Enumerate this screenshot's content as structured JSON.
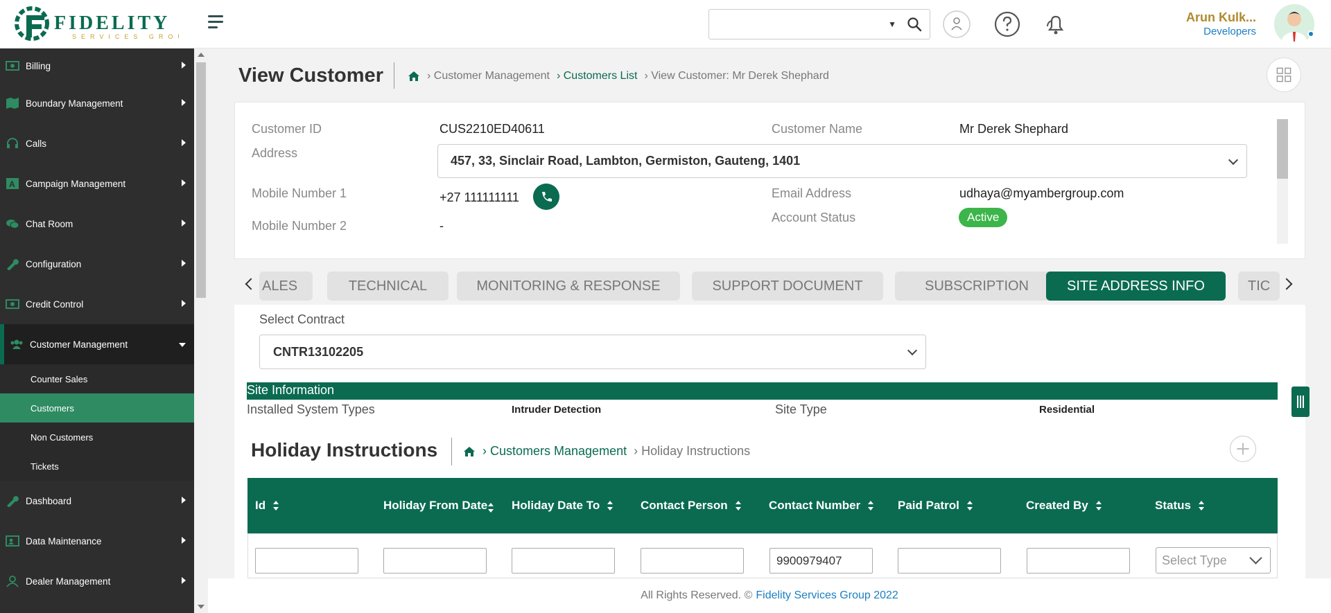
{
  "brand": {
    "name": "FIDELITY",
    "tagline": "SERVICES GROUP",
    "primary_color": "#0a6b50",
    "accent_color": "#c9a227"
  },
  "header": {
    "search_placeholder": "",
    "user_name": "Arun Kulk...",
    "user_role": "Developers"
  },
  "sidebar": {
    "items": [
      {
        "label": "Billing",
        "icon": "billing-icon"
      },
      {
        "label": "Boundary Management",
        "icon": "map-icon"
      },
      {
        "label": "Calls",
        "icon": "headset-icon"
      },
      {
        "label": "Campaign Management",
        "icon": "campaign-icon"
      },
      {
        "label": "Chat Room",
        "icon": "chat-icon"
      },
      {
        "label": "Configuration",
        "icon": "wrench-icon"
      },
      {
        "label": "Credit Control",
        "icon": "money-icon"
      },
      {
        "label": "Customer Management",
        "icon": "users-icon"
      },
      {
        "label": "Dashboard",
        "icon": "wrench-icon"
      },
      {
        "label": "Data Maintenance",
        "icon": "person-card-icon"
      },
      {
        "label": "Dealer Management",
        "icon": "user-icon"
      }
    ],
    "sub_items": [
      "Counter Sales",
      "Customers",
      "Non Customers",
      "Tickets"
    ]
  },
  "page": {
    "title": "View Customer",
    "breadcrumb": [
      "Customer Management",
      "Customers List",
      "View Customer: Mr Derek Shephard"
    ]
  },
  "customer": {
    "id_label": "Customer ID",
    "id_value": "CUS2210ED40611",
    "name_label": "Customer Name",
    "name_value": "Mr Derek Shephard",
    "address_label": "Address",
    "address_value": "457, 33, Sinclair Road, Lambton, Germiston, Gauteng, 1401",
    "mobile1_label": "Mobile Number 1",
    "mobile1_value": "+27 111111111",
    "mobile2_label": "Mobile Number 2",
    "mobile2_value": "-",
    "email_label": "Email Address",
    "email_value": "udhaya@myambergroup.com",
    "status_label": "Account Status",
    "status_value": "Active",
    "status_color": "#3cb54a"
  },
  "tabs": [
    "ALES",
    "TECHNICAL",
    "MONITORING & RESPONSE",
    "SUPPORT DOCUMENT",
    "SUBSCRIPTION",
    "SITE ADDRESS INFO",
    "TIC"
  ],
  "active_tab": "SITE ADDRESS INFO",
  "contract": {
    "label": "Select Contract",
    "value": "CNTR13102205"
  },
  "site_info": {
    "header": "Site Information",
    "installed_label": "Installed System Types",
    "installed_value": "Intruder Detection",
    "site_type_label": "Site Type",
    "site_type_value": "Residential"
  },
  "holiday": {
    "title": "Holiday Instructions",
    "breadcrumb": [
      "Customers Management",
      "Holiday Instructions"
    ],
    "columns": [
      "Id",
      "Holiday From Date",
      "Holiday Date To",
      "Contact Person",
      "Contact Number",
      "Paid Patrol",
      "Created By",
      "Status"
    ],
    "filters": [
      "",
      "",
      "",
      "",
      "9900979407",
      "",
      ""
    ],
    "status_placeholder": "Select Type"
  },
  "footer": {
    "text": "All Rights Reserved. ©",
    "link": "Fidelity Services Group 2022"
  }
}
